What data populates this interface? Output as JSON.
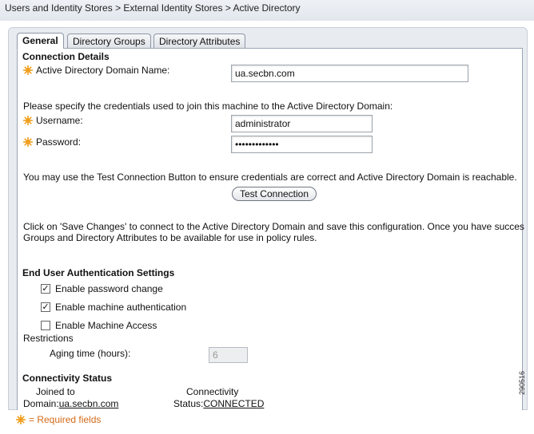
{
  "breadcrumb": "Users and Identity Stores > External Identity Stores > Active Directory",
  "tabs": [
    "General",
    "Directory Groups",
    "Directory Attributes"
  ],
  "connection": {
    "heading": "Connection Details",
    "domain_label": "Active Directory Domain Name:",
    "domain_value": "ua.secbn.com",
    "credentials_text": "Please specify the credentials used to join this machine to the Active Directory Domain:",
    "username_label": "Username:",
    "username_value": "administrator",
    "password_label": "Password:",
    "password_value": "•••••••••••••",
    "test_text": "You may use the Test Connection Button to ensure credentials are correct and Active Directory Domain is reachable.",
    "test_button": "Test Connection",
    "save_text_line1": "Click on 'Save Changes' to connect to the Active Directory Domain and save this configuration. Once you have succes",
    "save_text_line2": "Groups and Directory Attributes to be available for use in policy rules."
  },
  "auth": {
    "heading": "End User Authentication Settings",
    "password_change_label": "Enable password change",
    "password_change_checked": true,
    "machine_auth_label": "Enable machine authentication",
    "machine_auth_checked": true,
    "machine_access_label": "Enable Machine Access",
    "machine_access_checked": false,
    "restrictions_label": "Restrictions",
    "aging_label": "Aging time (hours):",
    "aging_value": "6"
  },
  "status": {
    "heading": "Connectivity Status",
    "joined_label_1": "Joined to",
    "joined_label_2": "Domain:",
    "joined_value": "ua.secbn.com",
    "conn_label_1": "Connectivity",
    "conn_label_2": "Status:",
    "conn_value": "CONNECTED"
  },
  "footer": {
    "required_text": "= Required fields"
  },
  "figure_id": "290516",
  "colors": {
    "required_icon": "#f0a020",
    "required_text": "#d46a1a"
  }
}
